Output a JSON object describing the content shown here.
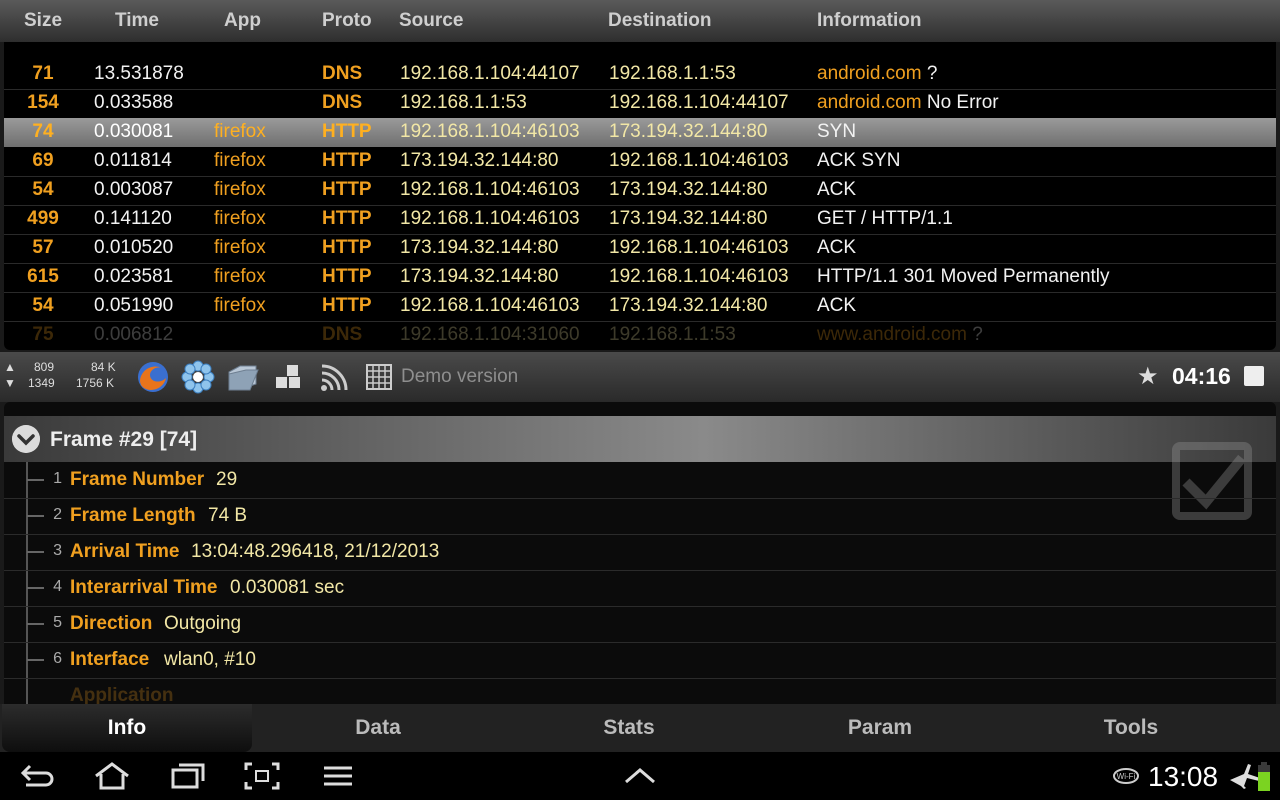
{
  "columns": {
    "size": "Size",
    "time": "Time",
    "app": "App",
    "proto": "Proto",
    "source": "Source",
    "destination": "Destination",
    "information": "Information"
  },
  "packets": [
    {
      "size": "71",
      "time": "13.531878",
      "app": "",
      "proto": "DNS",
      "source": "192.168.1.104:44107",
      "destination": "192.168.1.1:53",
      "info_hl": "android.com",
      "info": " ?"
    },
    {
      "size": "154",
      "time": "0.033588",
      "app": "",
      "proto": "DNS",
      "source": "192.168.1.1:53",
      "destination": "192.168.1.104:44107",
      "info_hl": "android.com",
      "info": " No Error"
    },
    {
      "size": "74",
      "time": "0.030081",
      "app": "firefox",
      "proto": "HTTP",
      "source": "192.168.1.104:46103",
      "destination": "173.194.32.144:80",
      "info_hl": "",
      "info": "SYN",
      "selected": true
    },
    {
      "size": "69",
      "time": "0.011814",
      "app": "firefox",
      "proto": "HTTP",
      "source": "173.194.32.144:80",
      "destination": "192.168.1.104:46103",
      "info_hl": "",
      "info": "ACK SYN"
    },
    {
      "size": "54",
      "time": "0.003087",
      "app": "firefox",
      "proto": "HTTP",
      "source": "192.168.1.104:46103",
      "destination": "173.194.32.144:80",
      "info_hl": "",
      "info": "ACK"
    },
    {
      "size": "499",
      "time": "0.141120",
      "app": "firefox",
      "proto": "HTTP",
      "source": "192.168.1.104:46103",
      "destination": "173.194.32.144:80",
      "info_hl": "",
      "info": "GET / HTTP/1.1"
    },
    {
      "size": "57",
      "time": "0.010520",
      "app": "firefox",
      "proto": "HTTP",
      "source": "173.194.32.144:80",
      "destination": "192.168.1.104:46103",
      "info_hl": "",
      "info": "ACK"
    },
    {
      "size": "615",
      "time": "0.023581",
      "app": "firefox",
      "proto": "HTTP",
      "source": "173.194.32.144:80",
      "destination": "192.168.1.104:46103",
      "info_hl": "",
      "info": "HTTP/1.1 301 Moved Permanently"
    },
    {
      "size": "54",
      "time": "0.051990",
      "app": "firefox",
      "proto": "HTTP",
      "source": "192.168.1.104:46103",
      "destination": "173.194.32.144:80",
      "info_hl": "",
      "info": "ACK"
    },
    {
      "size": "75",
      "time": "0.006812",
      "app": "",
      "proto": "DNS",
      "source": "192.168.1.104:31060",
      "destination": "192.168.1.1:53",
      "info_hl": "www.android.com",
      "info": " ?",
      "partial": true
    }
  ],
  "toolbar": {
    "packets_up": "809",
    "packets_down": "1349",
    "bytes_up": "84 K",
    "bytes_down": "1756 K",
    "demo_label": "Demo version",
    "capture_clock": "04:16",
    "icons": [
      "firefox-icon",
      "settings-flower-icon",
      "folder-icon",
      "blocks-icon",
      "wifi-icon",
      "grid-icon"
    ]
  },
  "frame": {
    "title": "Frame #29 [74]",
    "fields": [
      {
        "n": "1",
        "key": "Frame Number",
        "value": "29"
      },
      {
        "n": "2",
        "key": "Frame Length",
        "value": "74 B"
      },
      {
        "n": "3",
        "key": "Arrival Time",
        "value": "13:04:48.296418, 21/12/2013"
      },
      {
        "n": "4",
        "key": "Interarrival Time",
        "value": "0.030081 sec"
      },
      {
        "n": "5",
        "key": "Direction",
        "value": "Outgoing"
      },
      {
        "n": "6",
        "key": "Interface",
        "value": "wlan0, #10"
      }
    ]
  },
  "tabs": [
    "Info",
    "Data",
    "Stats",
    "Param",
    "Tools"
  ],
  "active_tab": "Info",
  "system": {
    "clock": "13:08"
  }
}
